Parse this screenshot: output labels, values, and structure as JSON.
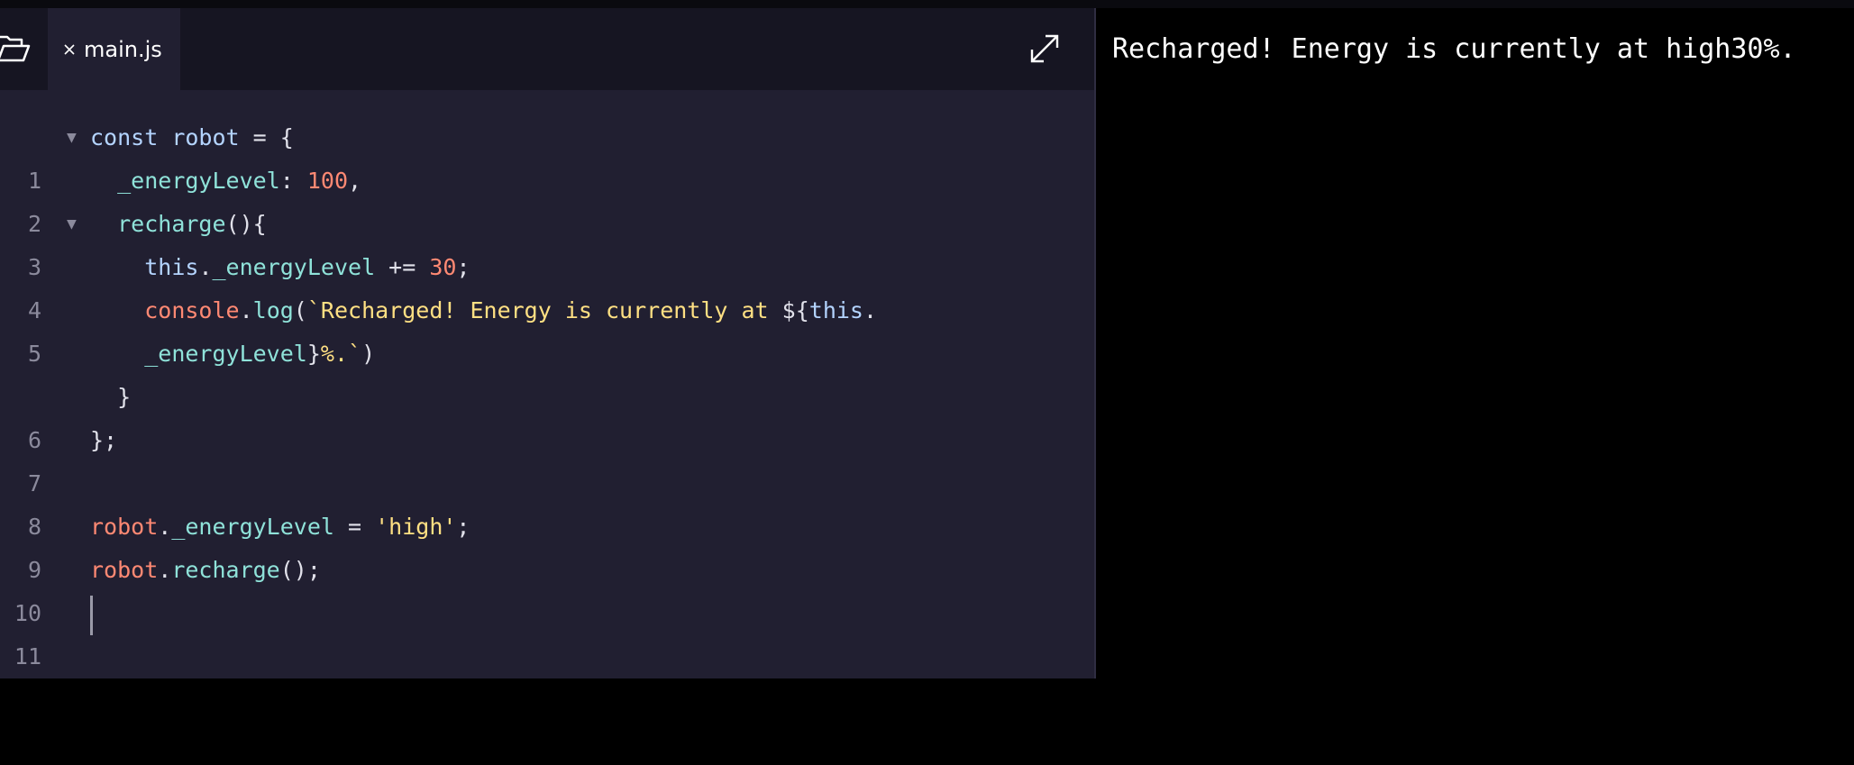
{
  "editor": {
    "tab_label": "main.js",
    "lines": [
      {
        "number": "1",
        "foldable": true
      },
      {
        "number": "2",
        "foldable": false
      },
      {
        "number": "3",
        "foldable": true
      },
      {
        "number": "4",
        "foldable": false
      },
      {
        "number": "5",
        "foldable": false
      },
      {
        "number": "",
        "foldable": false
      },
      {
        "number": "6",
        "foldable": false
      },
      {
        "number": "7",
        "foldable": false
      },
      {
        "number": "8",
        "foldable": false
      },
      {
        "number": "9",
        "foldable": false
      },
      {
        "number": "10",
        "foldable": false
      },
      {
        "number": "11",
        "foldable": false
      }
    ],
    "code": {
      "l1": {
        "kw": "const",
        "name": "robot",
        "rest": " = {"
      },
      "l2": {
        "prop": "_energyLevel",
        "sep": ": ",
        "num": "100",
        "end": ","
      },
      "l3": {
        "fn": "recharge",
        "end": "(){"
      },
      "l4": {
        "kw": "this",
        "dot": ".",
        "prop": "_energyLevel",
        "op": " += ",
        "num": "30",
        "end": ";"
      },
      "l5": {
        "obj": "console",
        "dot": ".",
        "fn": "log",
        "open": "(",
        "str": "`Recharged! Energy is currently at ",
        "interp_open": "${",
        "kw": "this",
        "dot2": "."
      },
      "l5b": {
        "prop": "_energyLevel",
        "interp_close": "}",
        "str": "%.`",
        "close": ")"
      },
      "l6": {
        "text": "}"
      },
      "l7": {
        "text": "};"
      },
      "l9": {
        "obj": "robot",
        "dot": ".",
        "prop": "_energyLevel",
        "op": " = ",
        "str": "'high'",
        "end": ";"
      },
      "l10": {
        "obj": "robot",
        "dot": ".",
        "fn": "recharge",
        "end": "();"
      }
    }
  },
  "console": {
    "output": "Recharged! Energy is currently at high30%."
  },
  "icons": {
    "folder": "folder-icon",
    "close": "close-icon",
    "expand": "expand-icon",
    "fold": "fold-arrow-icon"
  },
  "colors": {
    "editor_bg": "#211f31",
    "tabbar_bg": "#161522",
    "console_bg": "#000000",
    "keyword": "#b4d4ff",
    "property": "#8fe2d9",
    "number": "#ff8973",
    "string": "#ffe083"
  }
}
